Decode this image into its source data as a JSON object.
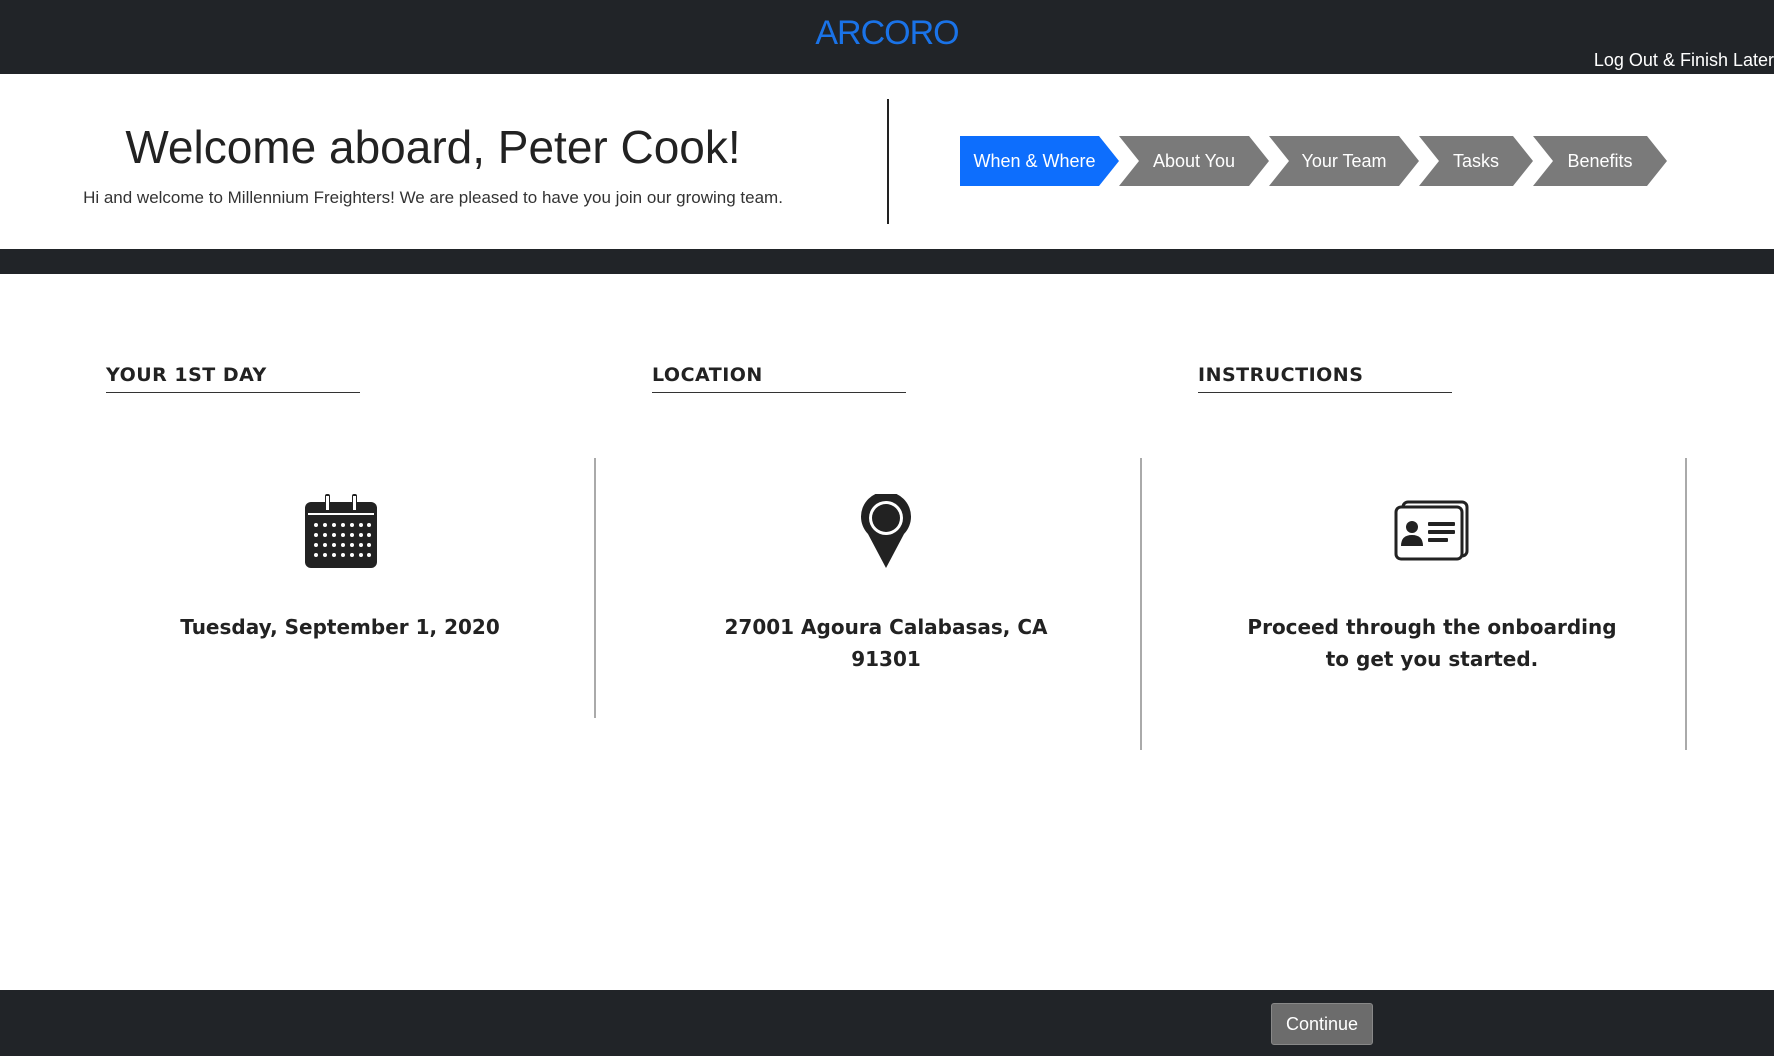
{
  "topbar": {
    "logo_text": "ARCORO",
    "logout_label": "Log Out & Finish Later"
  },
  "header": {
    "title": "Welcome aboard, Peter Cook!",
    "subtitle": "Hi and welcome to Millennium Freighters! We are pleased to have you join our growing team."
  },
  "steps": [
    {
      "label": "When & Where",
      "active": true
    },
    {
      "label": "About You",
      "active": false
    },
    {
      "label": "Your Team",
      "active": false
    },
    {
      "label": "Tasks",
      "active": false
    },
    {
      "label": "Benefits",
      "active": false
    }
  ],
  "sections": {
    "first_day": {
      "title": "YOUR 1ST DAY",
      "icon": "calendar-icon",
      "text": "Tuesday, September 1, 2020"
    },
    "location": {
      "title": "LOCATION",
      "icon": "map-pin-icon",
      "text_line1": "27001 Agoura Calabasas, CA",
      "text_line2": "91301"
    },
    "instructions": {
      "title": "INSTRUCTIONS",
      "icon": "id-card-icon",
      "text_line1": "Proceed through the onboarding",
      "text_line2": "to get you started."
    }
  },
  "footer": {
    "continue_label": "Continue"
  },
  "colors": {
    "dark_bar": "#212428",
    "active_step": "#0d6efd",
    "inactive_step": "#7a7a7a",
    "logo": "#1a73e8"
  }
}
